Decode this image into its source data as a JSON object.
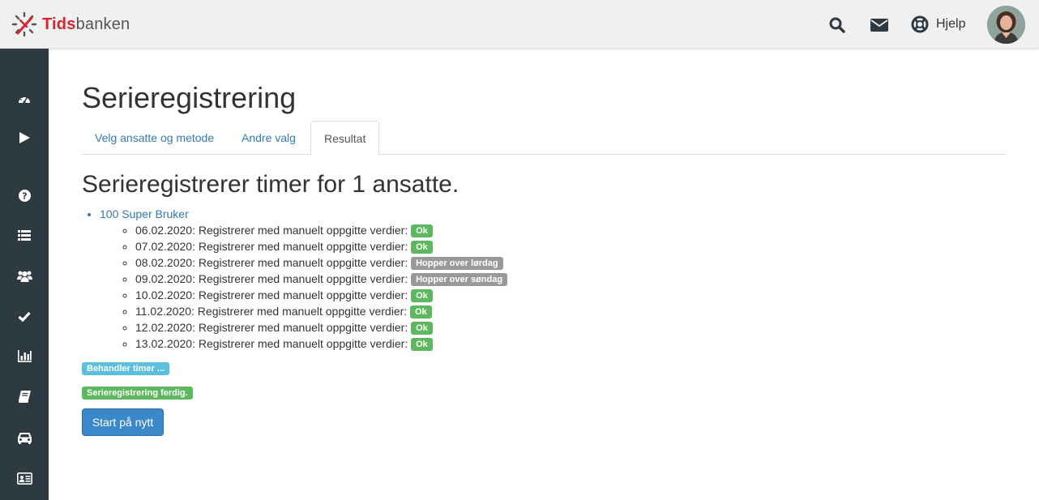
{
  "header": {
    "logo_text_a": "Tids",
    "logo_text_b": "banken",
    "help_label": "Hjelp"
  },
  "page": {
    "title": "Serieregistrering",
    "tabs": [
      {
        "label": "Velg ansatte og metode",
        "active": false
      },
      {
        "label": "Andre valg",
        "active": false
      },
      {
        "label": "Resultat",
        "active": true
      }
    ],
    "result_title": "Serieregistrerer timer for 1 ansatte."
  },
  "employees": [
    {
      "name": "100 Super Bruker",
      "days": [
        {
          "text": "06.02.2020: Registrerer med manuelt oppgitte verdier:",
          "badge": "Ok",
          "status": "ok"
        },
        {
          "text": "07.02.2020: Registrerer med manuelt oppgitte verdier:",
          "badge": "Ok",
          "status": "ok"
        },
        {
          "text": "08.02.2020: Registrerer med manuelt oppgitte verdier:",
          "badge": "Hopper over lørdag",
          "status": "skip"
        },
        {
          "text": "09.02.2020: Registrerer med manuelt oppgitte verdier:",
          "badge": "Hopper over søndag",
          "status": "skip"
        },
        {
          "text": "10.02.2020: Registrerer med manuelt oppgitte verdier:",
          "badge": "Ok",
          "status": "ok"
        },
        {
          "text": "11.02.2020: Registrerer med manuelt oppgitte verdier:",
          "badge": "Ok",
          "status": "ok"
        },
        {
          "text": "12.02.2020: Registrerer med manuelt oppgitte verdier:",
          "badge": "Ok",
          "status": "ok"
        },
        {
          "text": "13.02.2020: Registrerer med manuelt oppgitte verdier:",
          "badge": "Ok",
          "status": "ok"
        }
      ]
    }
  ],
  "status": {
    "processing": "Behandler timer ...",
    "done": "Serieregistrering ferdig."
  },
  "actions": {
    "restart_label": "Start på nytt"
  },
  "sidebar": {
    "items": [
      {
        "icon": "dashboard-icon"
      },
      {
        "icon": "play-icon"
      },
      {
        "icon": "question-icon"
      },
      {
        "icon": "list-icon"
      },
      {
        "icon": "users-icon"
      },
      {
        "icon": "check-icon"
      },
      {
        "icon": "bar-chart-icon"
      },
      {
        "icon": "book-icon"
      },
      {
        "icon": "car-icon"
      },
      {
        "icon": "id-card-icon"
      }
    ]
  },
  "colors": {
    "brand_red": "#d9232d",
    "sidebar_bg": "#2d3a42",
    "link_blue": "#337ab7",
    "ok_green": "#5cb85c",
    "skip_gray": "#999999",
    "info_cyan": "#5bc0de",
    "primary_button": "#3a87c9"
  }
}
